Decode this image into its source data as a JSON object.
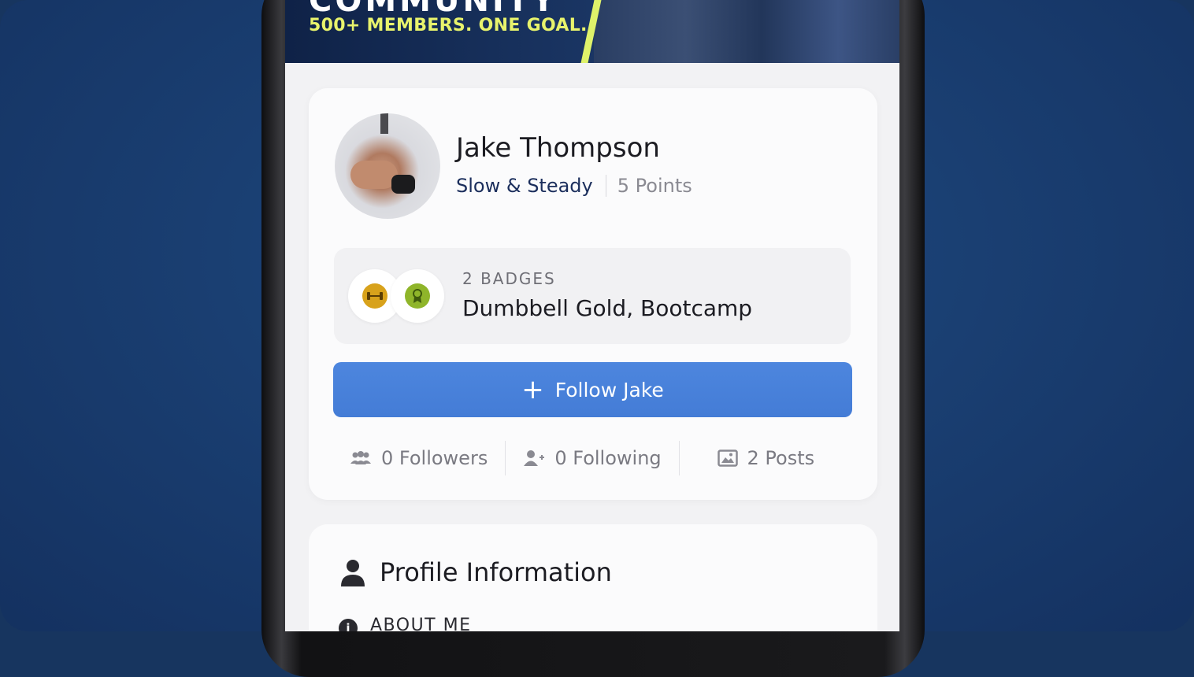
{
  "hero": {
    "headline": "COMMUNITY",
    "tagline": "500+ MEMBERS. ONE GOAL."
  },
  "profile": {
    "name": "Jake Thompson",
    "rank": "Slow & Steady",
    "points": "5 Points"
  },
  "badges": {
    "count_label": "2 BADGES",
    "list": "Dumbbell Gold, Bootcamp",
    "items": [
      {
        "icon": "dumbbell-icon",
        "color": "#d8a21b"
      },
      {
        "icon": "award-ribbon-icon",
        "color": "#8fb52a"
      }
    ]
  },
  "follow_button": {
    "label": "Follow Jake",
    "color": "#4a82db"
  },
  "stats": {
    "followers": "0 Followers",
    "following": "0 Following",
    "posts": "2 Posts"
  },
  "profile_info": {
    "title": "Profile Information",
    "about_label": "ABOUT ME"
  },
  "colors": {
    "background": "#1b3f72",
    "accent_lime": "#e8f36c",
    "rank_navy": "#1b2e5c"
  }
}
